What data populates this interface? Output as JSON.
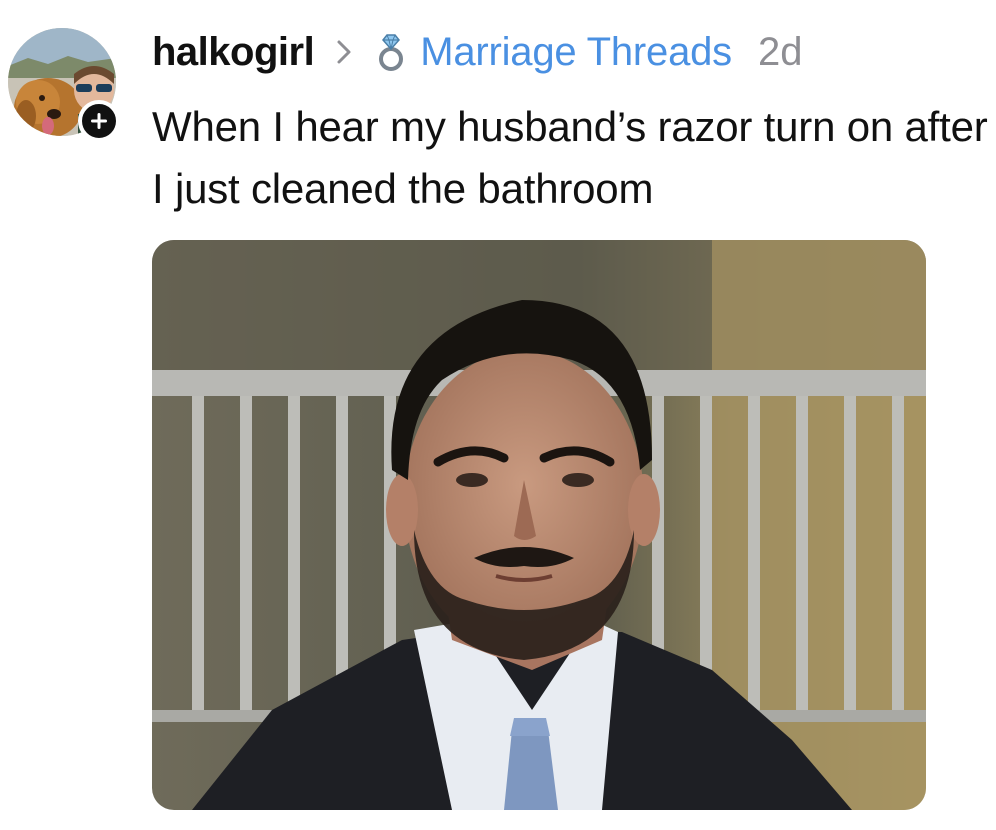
{
  "post": {
    "author": {
      "username": "halkogirl",
      "avatar_icon": "avatar-photo",
      "follow_icon": "plus-icon"
    },
    "breadcrumb_separator_icon": "chevron-right-icon",
    "group": {
      "icon": "ring-icon",
      "name": "Marriage Threads",
      "color": "#4a90e2"
    },
    "timestamp": "2d",
    "caption": "When I hear my husband’s razor turn on after I just cleaned the bathroom",
    "media": {
      "type": "photo"
    }
  }
}
